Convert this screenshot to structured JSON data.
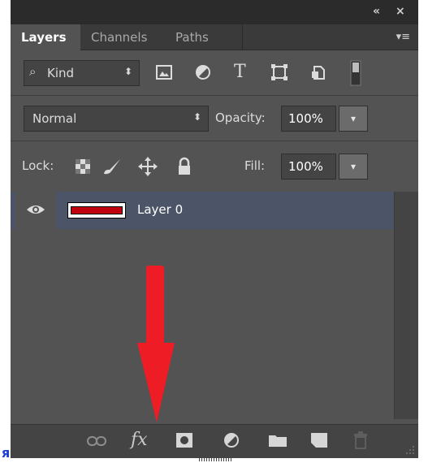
{
  "titlebar": {
    "collapse_glyph": "«",
    "close_glyph": "×"
  },
  "tabs": [
    {
      "label": "Layers",
      "active": true
    },
    {
      "label": "Channels",
      "active": false
    },
    {
      "label": "Paths",
      "active": false
    }
  ],
  "panel_menu_glyph": "▾≡",
  "filter": {
    "kind_label": "Kind",
    "search_glyph": "⌕",
    "arrow_glyph": "⬍",
    "icons": [
      "pixel-layer-filter-icon",
      "adjustment-layer-filter-icon",
      "type-layer-filter-icon",
      "shape-layer-filter-icon",
      "smart-object-filter-icon",
      "filter-toggle-icon"
    ],
    "type_glyph": "T"
  },
  "blend": {
    "mode": "Normal",
    "arrow_glyph": "⬍",
    "opacity_label": "Opacity:",
    "opacity_value": "100%",
    "dropdown_glyph": "▾"
  },
  "lock": {
    "label": "Lock:",
    "fill_label": "Fill:",
    "fill_value": "100%",
    "dropdown_glyph": "▾"
  },
  "layers": [
    {
      "name": "Layer 0",
      "visible": true,
      "thumb_color": "#c1000f",
      "selected": true
    }
  ],
  "footer": {
    "fx_label": "fx",
    "buttons": [
      "link-layers-icon",
      "fx-icon",
      "layer-mask-icon",
      "adjustment-layer-icon",
      "group-folder-icon",
      "new-layer-icon",
      "trash-icon"
    ]
  },
  "annotation": {
    "arrow_color": "#ee1c25"
  },
  "corner_text": "я",
  "colors": {
    "panel_bg": "#535353",
    "selected_layer": "#4b5567",
    "titlebar": "#2b2b2b"
  }
}
